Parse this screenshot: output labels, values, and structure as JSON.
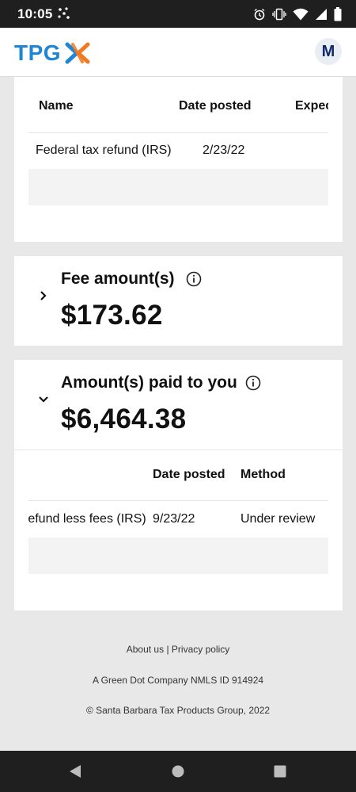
{
  "status_bar": {
    "time": "10:05"
  },
  "header": {
    "logo_text": "TPG",
    "avatar_letter": "M"
  },
  "refund_table": {
    "headers": [
      "Name",
      "Date posted",
      "Expec"
    ],
    "rows": [
      {
        "name": "Federal tax refund (IRS)",
        "date": "2/23/22"
      }
    ]
  },
  "fee_section": {
    "title": "Fee amount(s)",
    "amount": "$173.62"
  },
  "paid_section": {
    "title": "Amount(s) paid to you",
    "amount": "$6,464.38",
    "headers": [
      "Date posted",
      "Method"
    ],
    "rows": [
      {
        "name": "refund less fees (IRS)",
        "date": "9/23/22",
        "method": "Under review"
      }
    ]
  },
  "footer": {
    "about": "About us",
    "separator": "|",
    "privacy": "Privacy policy",
    "company": "A Green Dot Company NMLS ID 914924",
    "copyright": "© Santa Barbara Tax Products Group, 2022"
  },
  "colors": {
    "brand_blue": "#1f86d6",
    "brand_orange": "#f07a22",
    "avatar_text": "#102a6b"
  }
}
